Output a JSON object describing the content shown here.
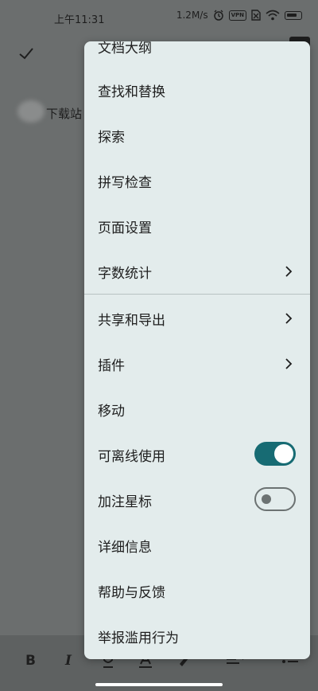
{
  "status_bar": {
    "time": "上午11:31",
    "speed": "1.2M/s",
    "vpn": "VPN"
  },
  "document": {
    "text": "下载站"
  },
  "menu": {
    "items": [
      {
        "label": "文档大纲",
        "has_chevron": false
      },
      {
        "label": "查找和替换",
        "has_chevron": false
      },
      {
        "label": "探索",
        "has_chevron": false
      },
      {
        "label": "拼写检查",
        "has_chevron": false
      },
      {
        "label": "页面设置",
        "has_chevron": false
      },
      {
        "label": "字数统计",
        "has_chevron": true
      },
      {
        "label": "共享和导出",
        "has_chevron": true
      },
      {
        "label": "插件",
        "has_chevron": true
      },
      {
        "label": "移动",
        "has_chevron": false
      },
      {
        "label": "可离线使用",
        "toggle": true,
        "toggle_on": true
      },
      {
        "label": "加注星标",
        "toggle": true,
        "toggle_on": false
      },
      {
        "label": "详细信息",
        "has_chevron": false
      },
      {
        "label": "帮助与反馈",
        "has_chevron": false
      },
      {
        "label": "举报滥用行为",
        "has_chevron": false
      }
    ]
  },
  "bottom_toolbar": {
    "bold": "B",
    "italic": "I"
  },
  "colors": {
    "toggle_on": "#176b73",
    "menu_bg": "#e3ecec",
    "scrim": "#6b6e6e"
  }
}
